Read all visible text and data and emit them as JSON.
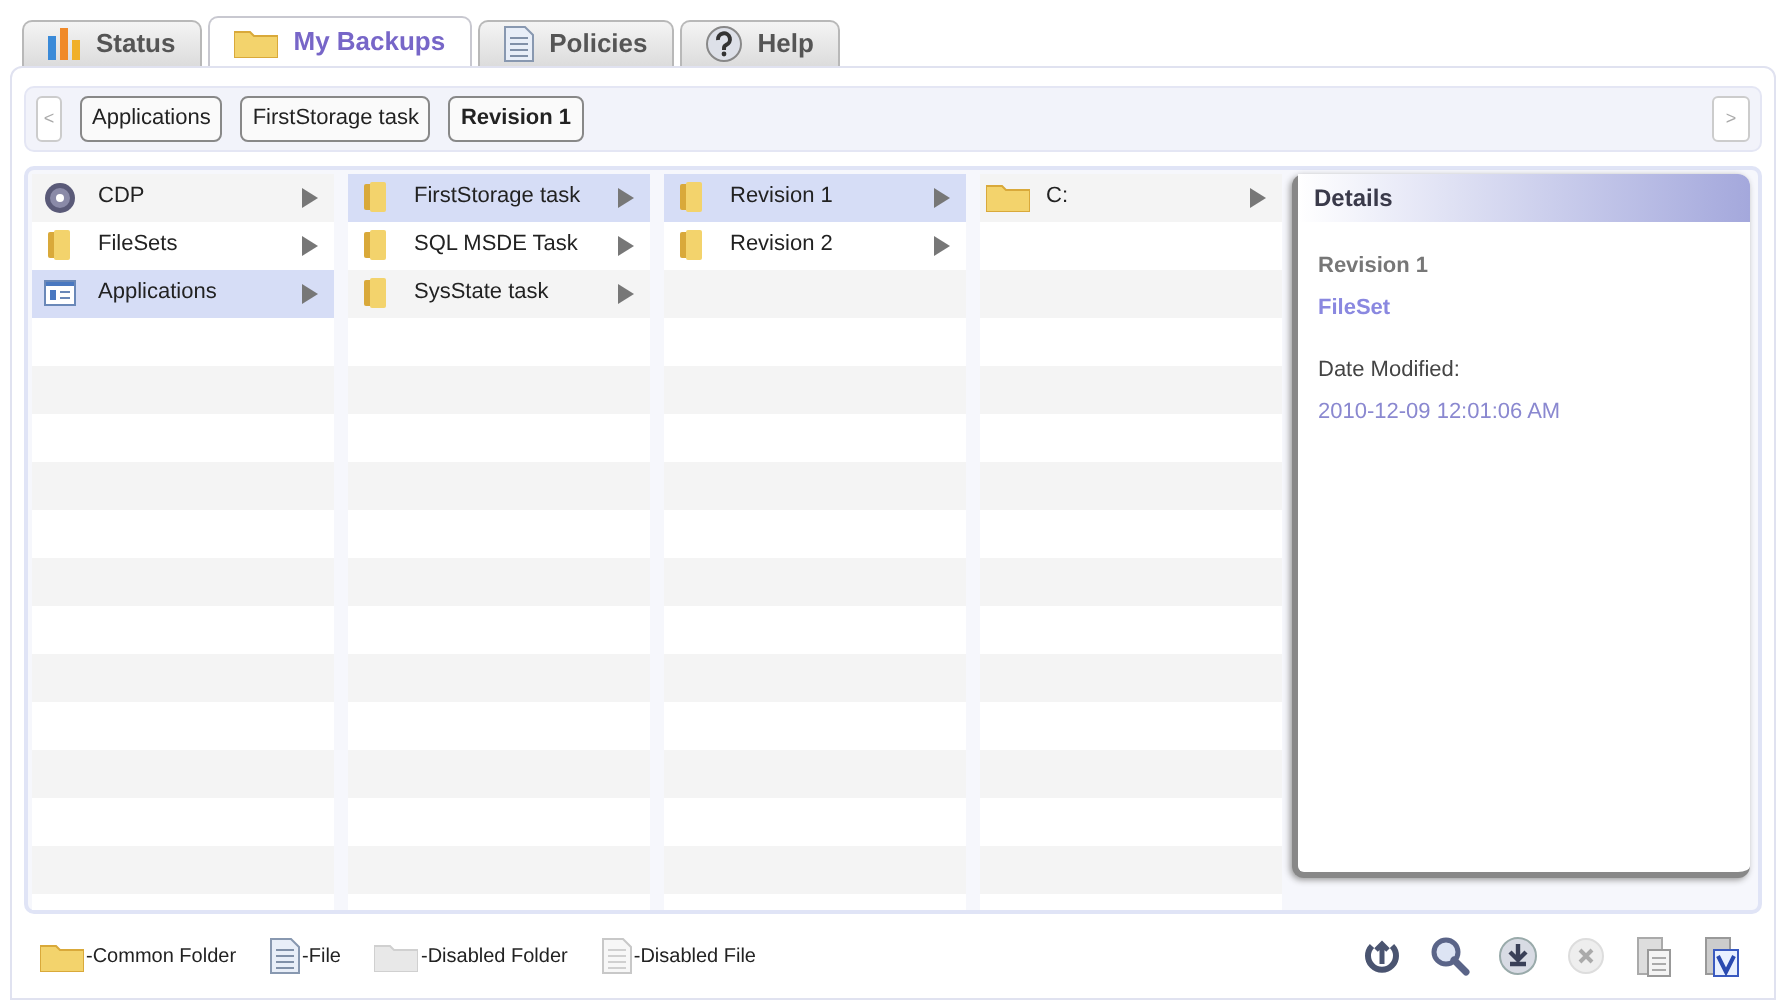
{
  "tabs": [
    {
      "label": "Status",
      "kind": "status",
      "selected": false
    },
    {
      "label": "My Backups",
      "kind": "backups",
      "selected": true
    },
    {
      "label": "Policies",
      "kind": "policies",
      "selected": false
    },
    {
      "label": "Help",
      "kind": "help",
      "selected": false
    }
  ],
  "breadcrumb": {
    "back": "<",
    "forward": ">",
    "items": [
      {
        "label": "Applications",
        "selected": false
      },
      {
        "label": "FirstStorage task",
        "selected": false
      },
      {
        "label": "Revision 1",
        "selected": true
      }
    ]
  },
  "columns": [
    [
      {
        "label": "CDP",
        "kind": "cdp",
        "selected": false
      },
      {
        "label": "FileSets",
        "kind": "folder",
        "selected": false
      },
      {
        "label": "Applications",
        "kind": "app",
        "selected": true
      }
    ],
    [
      {
        "label": "FirstStorage task",
        "kind": "folder",
        "selected": true
      },
      {
        "label": "SQL MSDE Task",
        "kind": "folder",
        "selected": false
      },
      {
        "label": "SysState task",
        "kind": "folder",
        "selected": false
      }
    ],
    [
      {
        "label": "Revision 1",
        "kind": "folder",
        "selected": true
      },
      {
        "label": "Revision 2",
        "kind": "folder",
        "selected": false
      }
    ],
    [
      {
        "label": "C:",
        "kind": "drive",
        "selected": false
      }
    ]
  ],
  "details": {
    "title": "Details",
    "name": "Revision 1",
    "type": "FileSet",
    "date_label": "Date Modified:",
    "date": "2010-12-09 12:01:06 AM"
  },
  "legend": [
    {
      "kind": "folder",
      "label": "-Common Folder"
    },
    {
      "kind": "file",
      "label": "-File"
    },
    {
      "kind": "disabled-folder",
      "label": "-Disabled Folder"
    },
    {
      "kind": "disabled-file",
      "label": "-Disabled File"
    }
  ]
}
